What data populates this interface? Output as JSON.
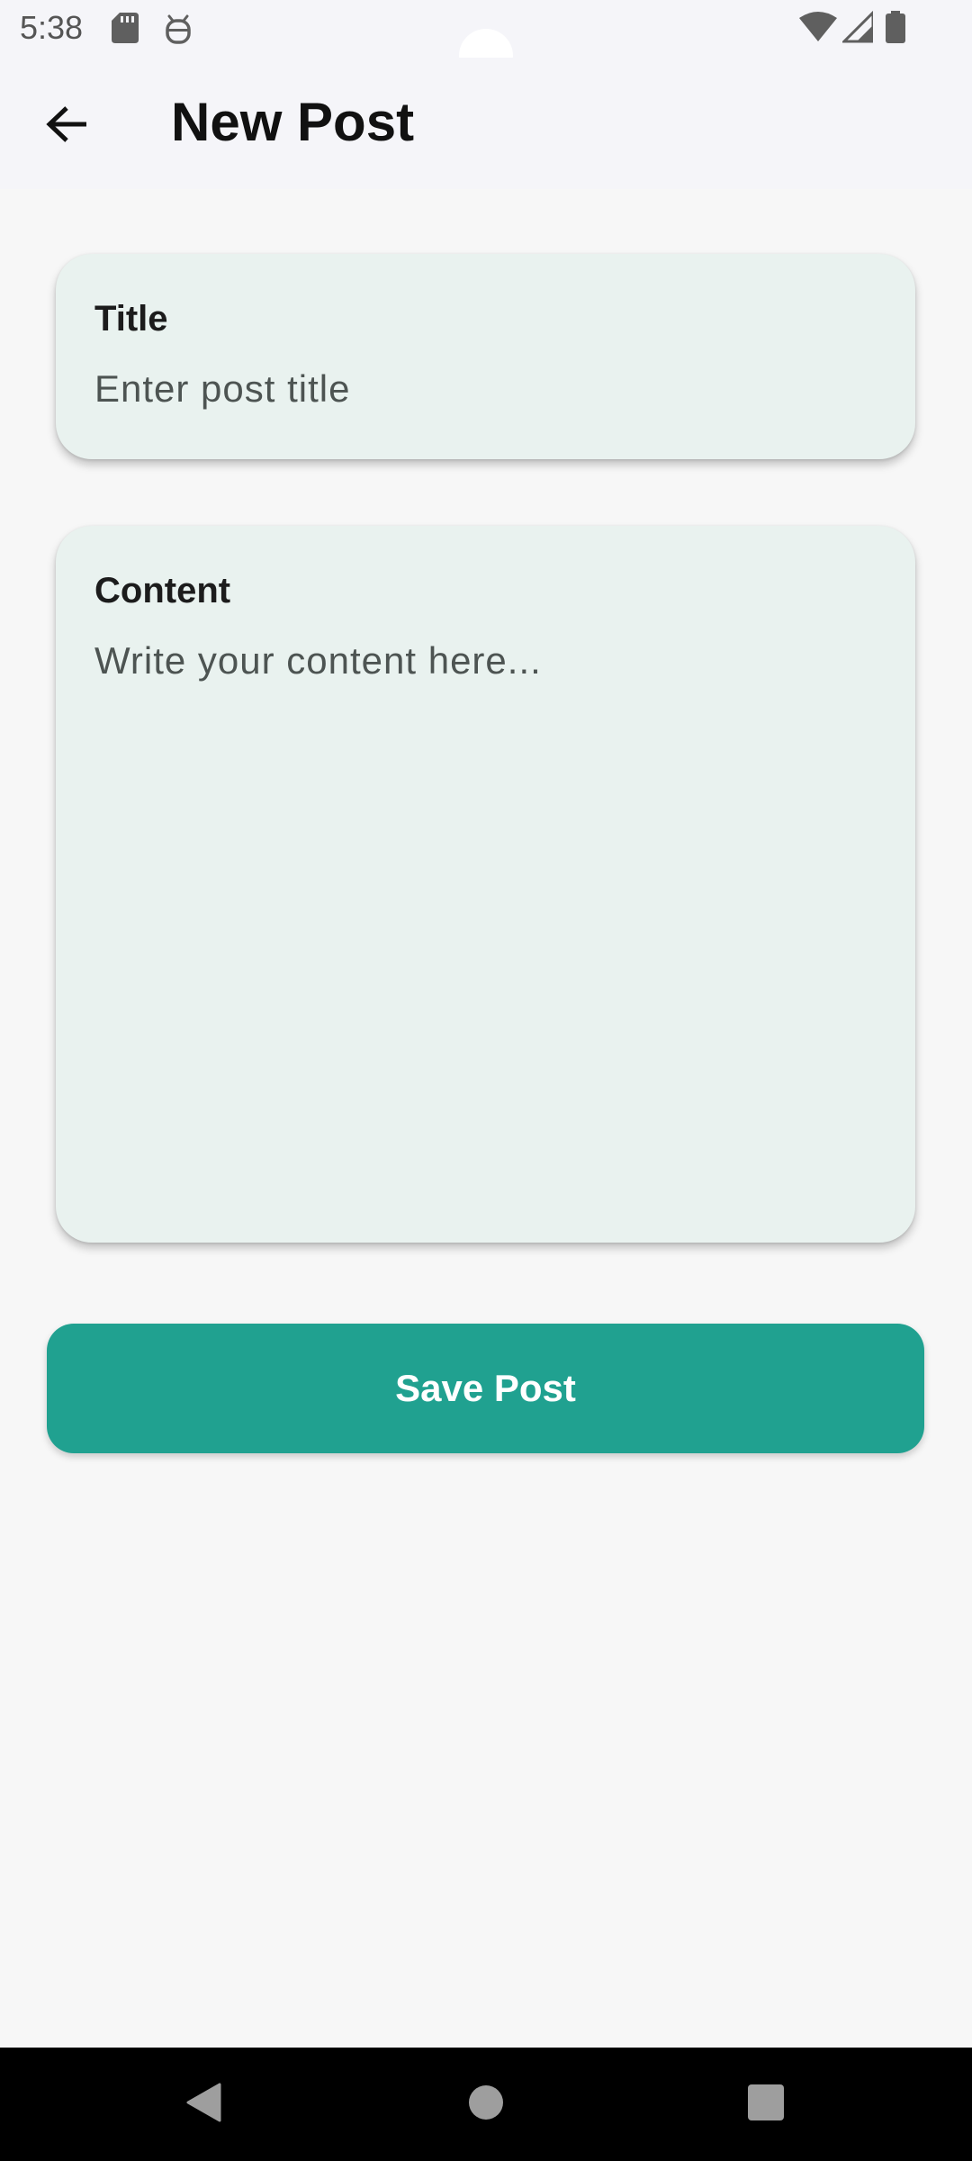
{
  "status_bar": {
    "time": "5:38",
    "left_icons": [
      "sd-card-icon",
      "android-debug-icon"
    ],
    "right_icons": [
      "wifi-icon",
      "signal-icon",
      "battery-icon"
    ]
  },
  "app_bar": {
    "back_icon": "arrow-back-icon",
    "title": "New Post"
  },
  "form": {
    "title_field": {
      "label": "Title",
      "value": "",
      "placeholder": "Enter post title"
    },
    "content_field": {
      "label": "Content",
      "value": "",
      "placeholder": "Write your content here..."
    },
    "save_button_label": "Save Post"
  },
  "nav_bar": {
    "buttons": [
      "back-triangle-icon",
      "home-circle-icon",
      "recents-square-icon"
    ]
  },
  "colors": {
    "accent": "#20a190",
    "card_background": "#e9f2ef",
    "page_background": "#f7f7f7",
    "app_bar_background": "#f5f5f9"
  }
}
